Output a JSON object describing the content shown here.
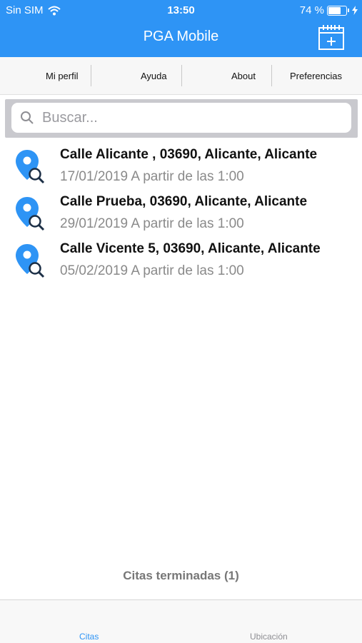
{
  "status_bar": {
    "carrier": "Sin SIM",
    "time": "13:50",
    "battery_percent": 74,
    "battery_label": "74 %"
  },
  "header": {
    "title": "PGA Mobile",
    "calendar_icon": "calendar-add-icon",
    "bg_color": "#2e94f5"
  },
  "menu": {
    "items": [
      "Mi perfil",
      "Ayuda",
      "About",
      "Preferencias"
    ]
  },
  "search": {
    "placeholder": "Buscar..."
  },
  "appointments": [
    {
      "address": "Calle Alicante , 03690, Alicante, Alicante",
      "date": "17/01/2019 A partir de las 1:00",
      "icon": "location-search-icon"
    },
    {
      "address": "Calle Prueba, 03690, Alicante, Alicante",
      "date": "29/01/2019 A partir de las 1:00",
      "icon": "location-search-icon"
    },
    {
      "address": "Calle Vicente 5, 03690, Alicante, Alicante",
      "date": "05/02/2019 A partir de las 1:00",
      "icon": "location-search-icon"
    }
  ],
  "footer": {
    "finished_label": "Citas terminadas (1)"
  },
  "tabs": [
    {
      "label": "Citas",
      "active": true
    },
    {
      "label": "Ubicación",
      "active": false
    }
  ]
}
